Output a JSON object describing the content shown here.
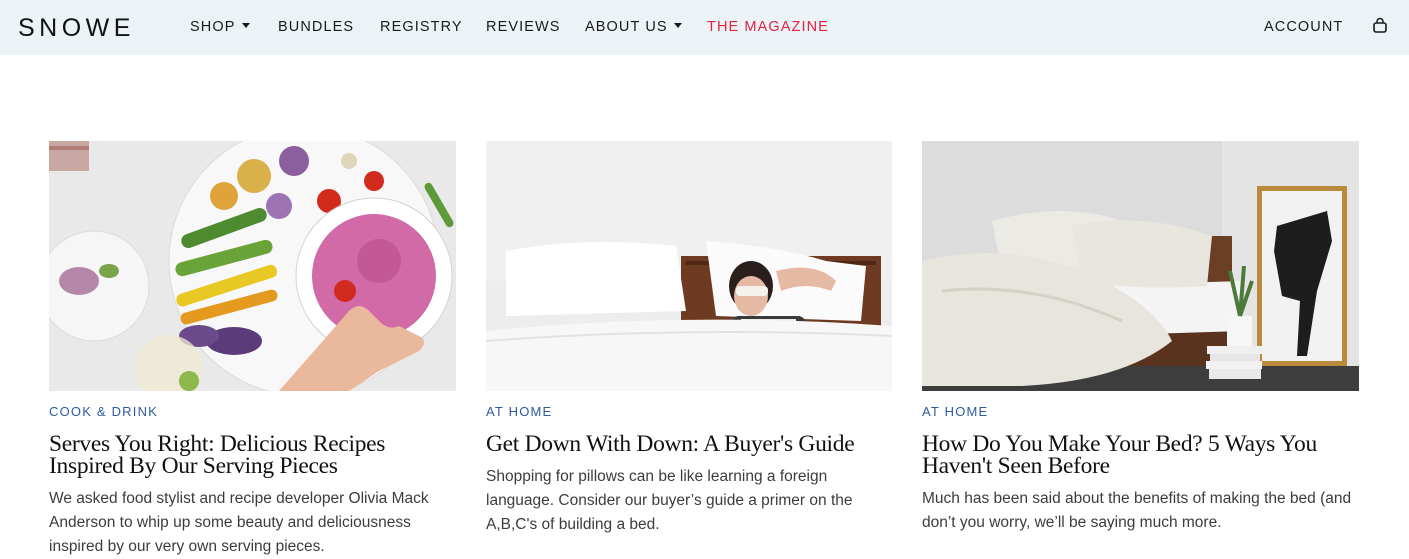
{
  "brand": {
    "logo": "SNOWE"
  },
  "nav": {
    "items": [
      {
        "label": "SHOP",
        "has_dropdown": true
      },
      {
        "label": "BUNDLES",
        "has_dropdown": false
      },
      {
        "label": "REGISTRY",
        "has_dropdown": false
      },
      {
        "label": "REVIEWS",
        "has_dropdown": false
      },
      {
        "label": "ABOUT US",
        "has_dropdown": true
      },
      {
        "label": "THE MAGAZINE",
        "has_dropdown": false,
        "accent": "#e0233f"
      }
    ],
    "account_label": "ACCOUNT",
    "cart_icon": "shopping-bag-icon"
  },
  "colors": {
    "header_bg": "#ecf3f6",
    "category_blue": "#2d5aa0",
    "magazine_red": "#e0233f"
  },
  "articles": [
    {
      "category": "COOK & DRINK",
      "title": "Serves You Right: Delicious Recipes Inspired By Our Serving Pieces",
      "excerpt": "We asked food stylist and recipe developer Olivia Mack Anderson to whip up some beauty and deliciousness inspired by our very own serving pieces.",
      "image": "platter-with-pink-dip-and-vegetables"
    },
    {
      "category": "AT HOME",
      "title": "Get Down With Down: A Buyer's Guide",
      "excerpt": "Shopping for pillows can be like learning a foreign language.  Consider our buyer’s guide a primer on the A,B,C's of building a bed.",
      "image": "woman-sleeping-with-eye-mask"
    },
    {
      "category": "AT HOME",
      "title": "How Do You Make Your Bed? 5 Ways You Haven't Seen Before",
      "excerpt": "Much has been said about the benefits of making the bed (and don’t you worry, we’ll be saying much more.",
      "image": "bed-with-horse-artwork"
    }
  ]
}
